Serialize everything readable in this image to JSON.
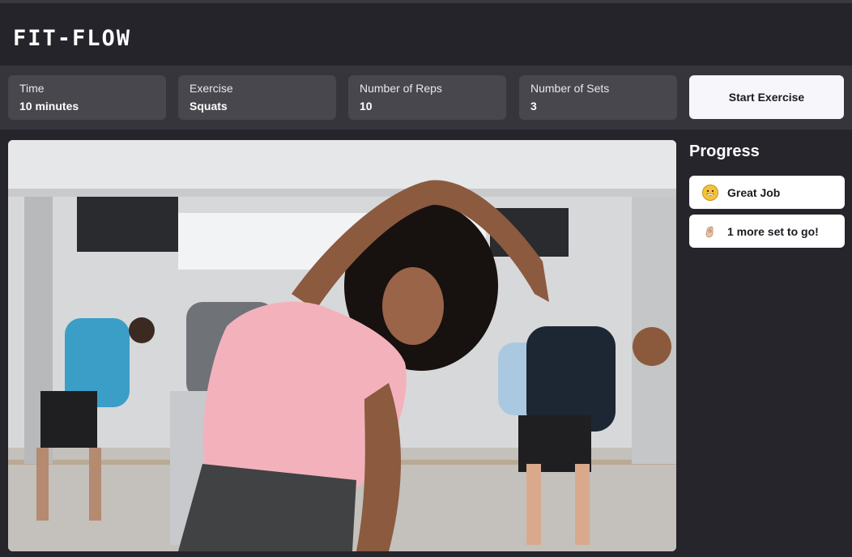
{
  "app": {
    "title": "FIT-FLOW"
  },
  "toolbar": {
    "fields": [
      {
        "label": "Time",
        "value": "10 minutes"
      },
      {
        "label": "Exercise",
        "value": "Squats"
      },
      {
        "label": "Number of Reps",
        "value": "10"
      },
      {
        "label": "Number of Sets",
        "value": "3"
      }
    ],
    "start_label": "Start Exercise"
  },
  "progress": {
    "title": "Progress",
    "items": [
      {
        "icon": "smiley-face-icon",
        "text": "Great Job"
      },
      {
        "icon": "pinch-hand-icon",
        "text": "1 more set to go!"
      }
    ]
  },
  "colors": {
    "background": "#26252b",
    "toolbar": "#36353b",
    "field": "#48474d",
    "button": "#f7f6fb"
  }
}
